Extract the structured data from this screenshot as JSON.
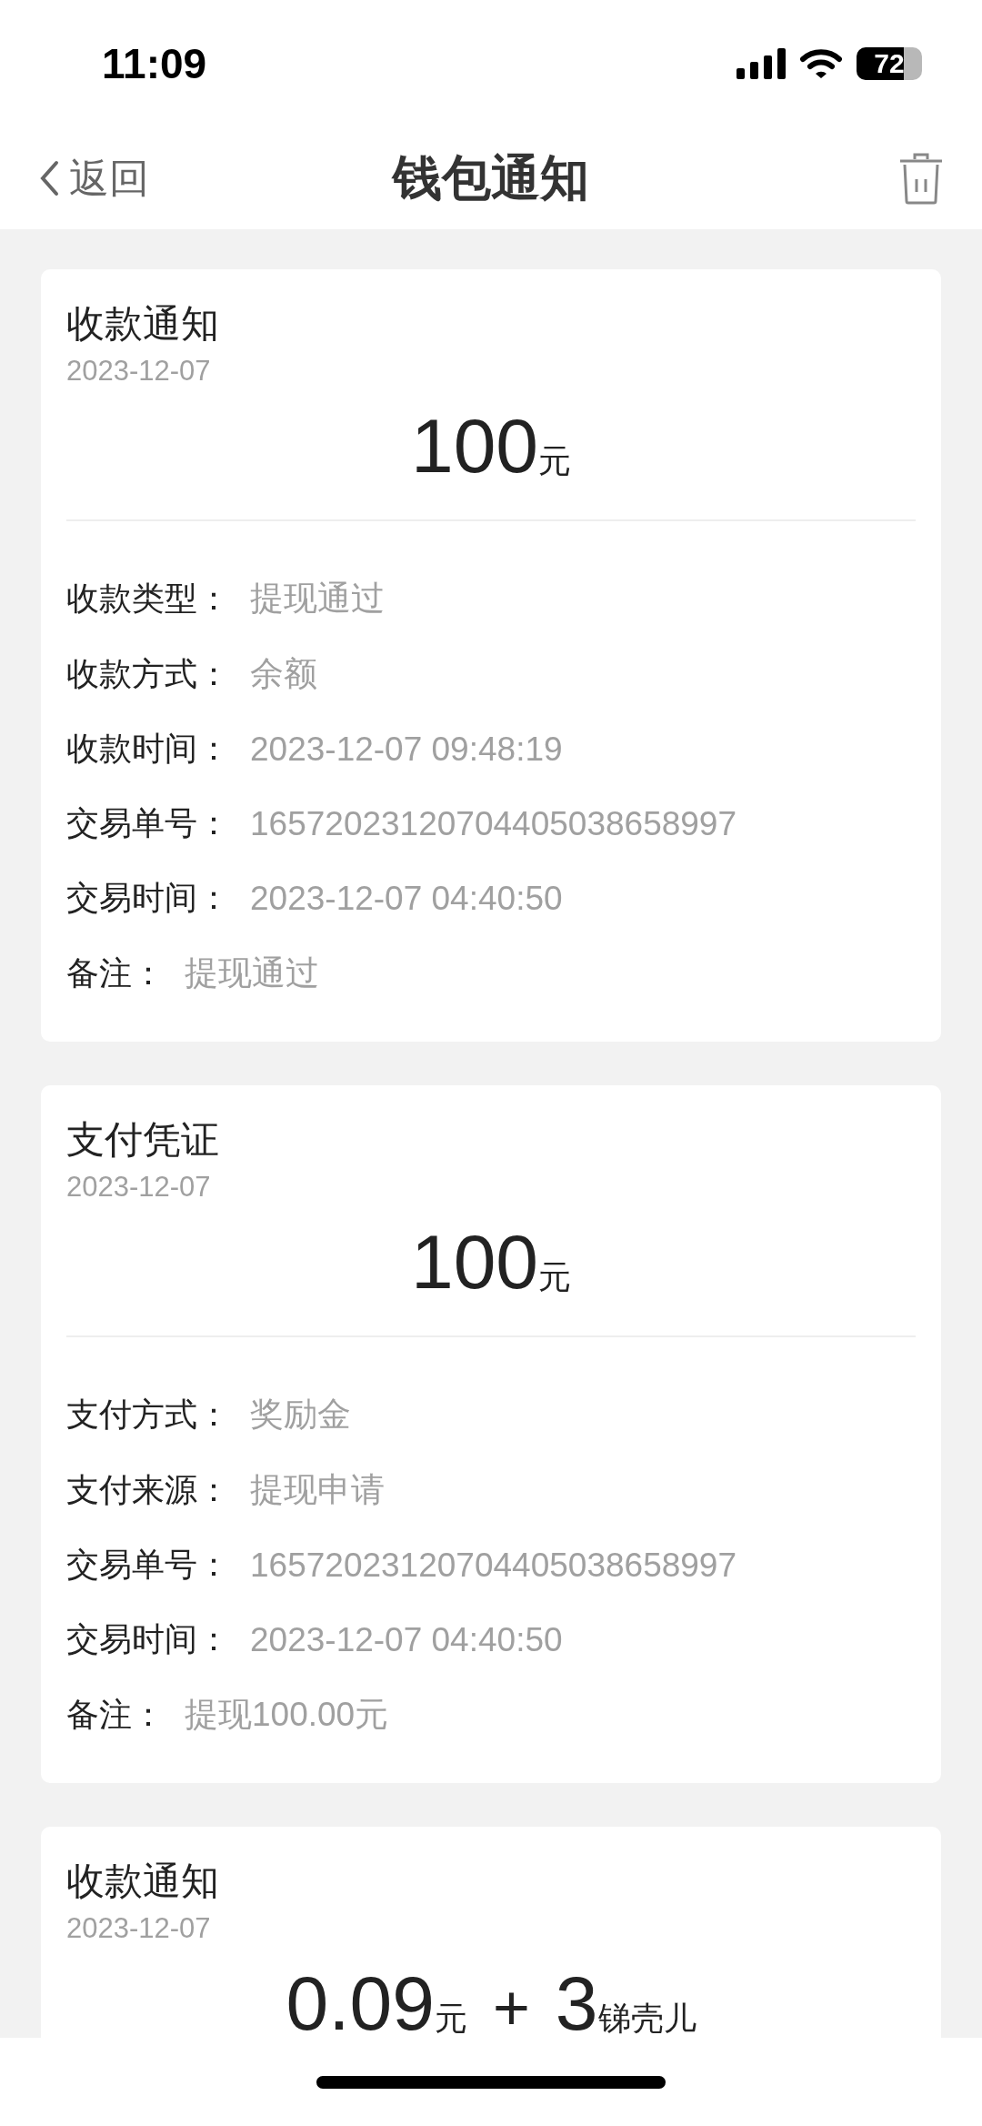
{
  "status_bar": {
    "time": "11:09",
    "battery": "72"
  },
  "nav": {
    "back": "返回",
    "title": "钱包通知"
  },
  "cards": [
    {
      "title": "收款通知",
      "date": "2023-12-07",
      "amount": [
        {
          "kind": "number",
          "text": "100"
        },
        {
          "kind": "unit",
          "text": "元"
        }
      ],
      "rows": [
        {
          "label": "收款类型：",
          "value": "提现通过"
        },
        {
          "label": "收款方式：",
          "value": "余额"
        },
        {
          "label": "收款时间：",
          "value": "2023-12-07 09:48:19"
        },
        {
          "label": "交易单号：",
          "value": "16572023120704405038658997"
        },
        {
          "label": "交易时间：",
          "value": "2023-12-07 04:40:50"
        },
        {
          "label": "备注：",
          "value": "提现通过"
        }
      ]
    },
    {
      "title": "支付凭证",
      "date": "2023-12-07",
      "amount": [
        {
          "kind": "number",
          "text": "100"
        },
        {
          "kind": "unit",
          "text": "元"
        }
      ],
      "rows": [
        {
          "label": "支付方式：",
          "value": "奖励金"
        },
        {
          "label": "支付来源：",
          "value": "提现申请"
        },
        {
          "label": "交易单号：",
          "value": "16572023120704405038658997"
        },
        {
          "label": "交易时间：",
          "value": "2023-12-07 04:40:50"
        },
        {
          "label": "备注：",
          "value": "提现100.00元"
        }
      ]
    },
    {
      "title": "收款通知",
      "date": "2023-12-07",
      "amount": [
        {
          "kind": "number",
          "text": "0.09"
        },
        {
          "kind": "unit",
          "text": "元"
        },
        {
          "kind": "operator",
          "text": "+"
        },
        {
          "kind": "number",
          "text": "3"
        },
        {
          "kind": "unit",
          "text": "锑壳儿"
        }
      ]
    }
  ]
}
